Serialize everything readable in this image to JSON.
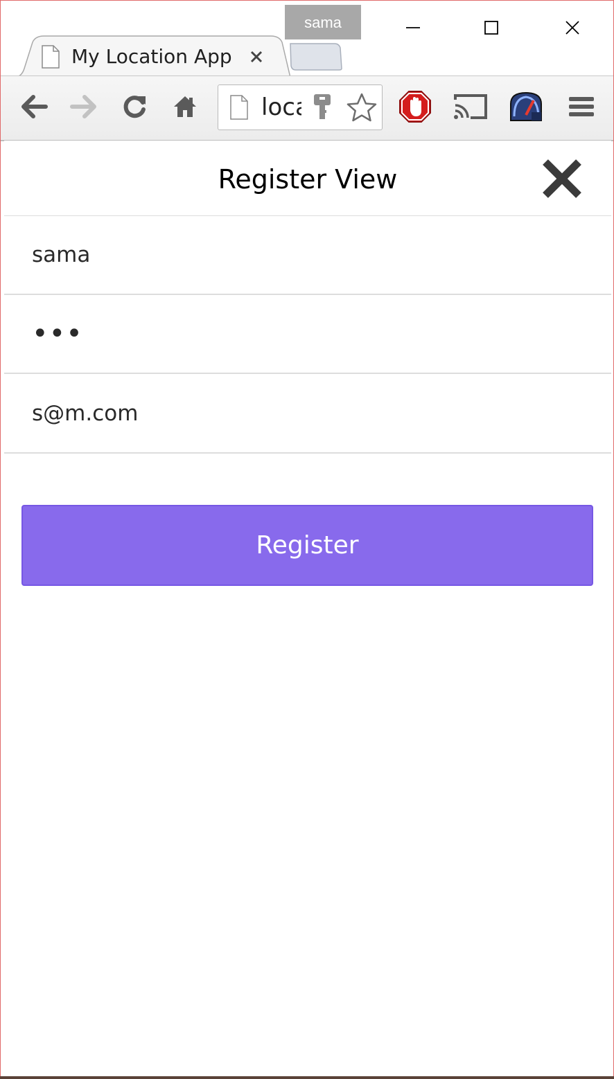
{
  "window": {
    "profile_name": "sama",
    "tab_title": "My Location App",
    "omnibox_text": "localhost"
  },
  "page": {
    "title": "Register View",
    "fields": {
      "username_value": "sama",
      "password_value": "abc",
      "email_value": "s@m.com"
    },
    "register_label": "Register"
  },
  "colors": {
    "accent": "#886aec",
    "adblock_red": "#d41d1d"
  },
  "icons": {
    "back": "arrow-left-icon",
    "forward": "arrow-right-icon",
    "reload": "reload-icon",
    "home": "home-icon",
    "key": "key-icon",
    "star": "star-icon",
    "adblock": "hand-stop-icon",
    "cast": "cast-icon",
    "speedometer": "speedometer-icon",
    "menu": "hamburger-icon",
    "close": "close-icon"
  }
}
